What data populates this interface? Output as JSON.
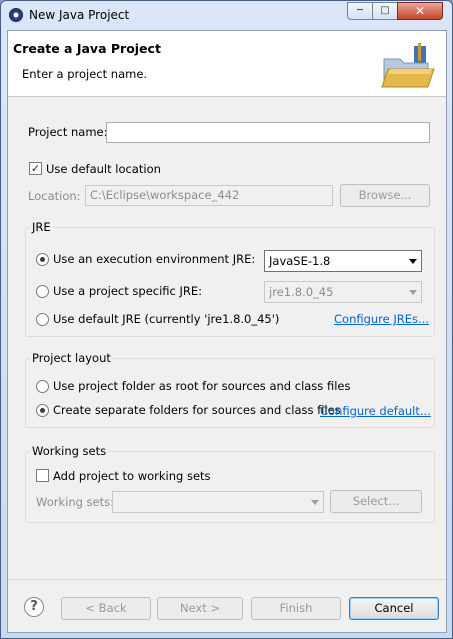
{
  "window": {
    "title": "New Java Project",
    "icon": "eclipse-icon",
    "controls": {
      "minimize": "minimize-icon",
      "maximize": "maximize-icon",
      "close": "close-icon"
    }
  },
  "header": {
    "title": "Create a Java Project",
    "message": "Enter a project name.",
    "banner_icon": "new-java-project-wizard-icon"
  },
  "project": {
    "name_label": "Project name:",
    "name_value": "",
    "use_default_location_label": "Use default location",
    "use_default_location_checked": true,
    "location_label": "Location:",
    "location_value": "C:\\Eclipse\\workspace_442",
    "browse_label": "Browse..."
  },
  "jre": {
    "title": "JRE",
    "options": [
      {
        "label": "Use an execution environment JRE:",
        "selected": true
      },
      {
        "label": "Use a project specific JRE:",
        "selected": false
      },
      {
        "label": "Use default JRE (currently 'jre1.8.0_45')",
        "selected": false
      }
    ],
    "execution_env_value": "JavaSE-1.8",
    "specific_jre_value": "jre1.8.0_45",
    "configure_link": "Configure JREs..."
  },
  "layout": {
    "title": "Project layout",
    "options": [
      {
        "label": "Use project folder as root for sources and class files",
        "selected": false
      },
      {
        "label": "Create separate folders for sources and class files",
        "selected": true
      }
    ],
    "configure_link": "Configure default..."
  },
  "working_sets": {
    "title": "Working sets",
    "add_label": "Add project to working sets",
    "add_checked": false,
    "field_label": "Working sets:",
    "field_value": "",
    "select_label": "Select..."
  },
  "footer": {
    "help_icon": "help-icon",
    "back_label": "< Back",
    "next_label": "Next >",
    "finish_label": "Finish",
    "cancel_label": "Cancel"
  }
}
